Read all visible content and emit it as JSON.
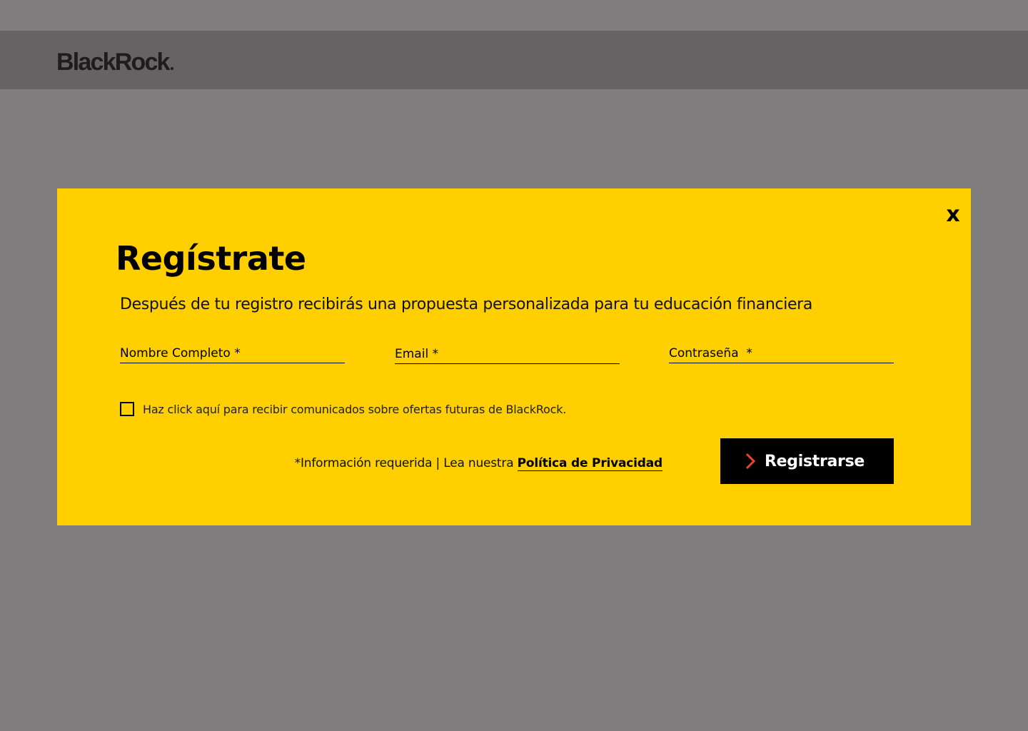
{
  "header": {
    "logo_text": "BlackRock"
  },
  "modal": {
    "close_label": "x",
    "title": "Regístrate",
    "subtitle": "Después de tu registro recibirás una propuesta personalizada para tu educación financiera",
    "fields": {
      "full_name_placeholder": "Nombre Completo *",
      "email_placeholder": "Email *",
      "password_placeholder": "Contraseña  *"
    },
    "checkbox_label": "Haz click aquí para recibir comunicados sobre ofertas futuras de BlackRock.",
    "required_note": "*Información requerida | Lea nuestra ",
    "privacy_link": "Política de Privacidad",
    "submit_label": "Registrarse"
  },
  "colors": {
    "overlay_bg": "#7f7d7e",
    "header_bg": "#656364",
    "modal_bg": "#ffcf00",
    "button_bg": "#000000",
    "button_arrow": "#e8442a"
  },
  "icons": {
    "close": "close-icon",
    "submit_arrow": "chevron-right-icon"
  }
}
